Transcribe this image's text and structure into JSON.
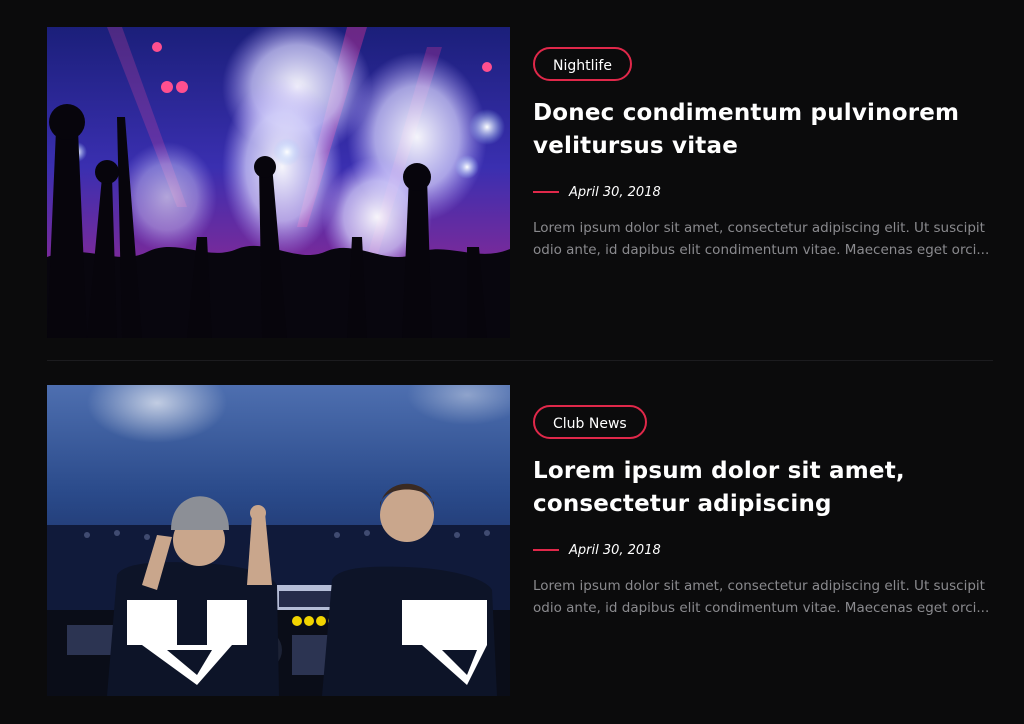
{
  "posts": [
    {
      "tag": "Nightlife",
      "title": "Donec condimentum pulvinorem velitursus vitae",
      "date": "April 30, 2018",
      "excerpt": "Lorem ipsum dolor sit amet, consectetur adipiscing elit. Ut suscipit odio ante, id dapibus elit condimentum vitae. Maecenas eget orci..."
    },
    {
      "tag": "Club News",
      "title": "Lorem ipsum dolor sit amet, consectetur adipiscing",
      "date": "April 30, 2018",
      "excerpt": "Lorem ipsum dolor sit amet, consectetur adipiscing elit. Ut suscipit odio ante, id dapibus elit condimentum vitae. Maecenas eget orci..."
    }
  ],
  "colors": {
    "accent": "#e0284a",
    "background": "#0b0b0c",
    "excerpt": "#8a8a8e"
  }
}
